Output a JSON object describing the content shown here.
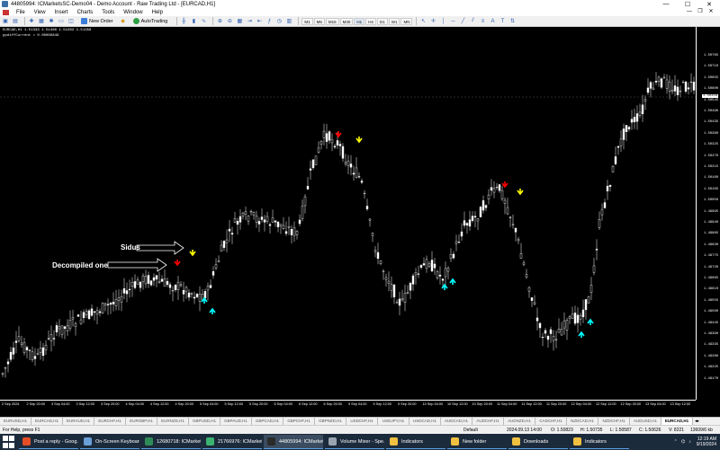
{
  "window": {
    "title": "44805994: ICMarketsSC-Demo04 - Demo Account - Raw Trading Ltd - [EURCAD,H1]",
    "minimize": "—",
    "maximize": "☐",
    "close": "✕"
  },
  "menu": {
    "items": [
      "File",
      "View",
      "Insert",
      "Charts",
      "Tools",
      "Window",
      "Help"
    ]
  },
  "toolbar": {
    "new_order": "New Order",
    "auto_trading": "AutoTrading",
    "timeframes": [
      "M1",
      "M5",
      "M15",
      "M30",
      "H1",
      "H4",
      "D1",
      "W1",
      "MN"
    ],
    "active_timeframe": "H1"
  },
  "chart": {
    "symbol_line": "EURCAD,H1  1.51333 1.51460 1.51282 1.51358",
    "indicator_line": "ppdiffCurrent = 0.00009849",
    "annotation_sidus": "Sidus",
    "annotation_decompiled": "Decompiled one",
    "price_labels": [
      "1.50765",
      "1.50710",
      "1.50655",
      "1.50600",
      "1.50545",
      "1.50490",
      "1.50435",
      "1.50380",
      "1.50325",
      "1.50270",
      "1.50215",
      "1.50160",
      "1.50105",
      "1.50050",
      "1.49995",
      "1.49940",
      "1.49885",
      "1.49830",
      "1.49775",
      "1.49720",
      "1.49665",
      "1.49610",
      "1.49555",
      "1.49500",
      "1.49445",
      "1.49390",
      "1.49335",
      "1.49280",
      "1.49225",
      "1.49170"
    ],
    "current_price": "1.50358",
    "time_labels": [
      "2 Sep 2024",
      "2 Sep 20:00",
      "3 Sep 04:00",
      "3 Sep 12:00",
      "3 Sep 20:00",
      "4 Sep 04:00",
      "4 Sep 12:00",
      "4 Sep 20:00",
      "5 Sep 04:00",
      "5 Sep 12:00",
      "5 Sep 20:00",
      "6 Sep 04:00",
      "6 Sep 12:00",
      "6 Sep 20:00",
      "9 Sep 04:00",
      "9 Sep 12:00",
      "9 Sep 20:00",
      "10 Sep 04:00",
      "10 Sep 12:00",
      "10 Sep 20:00",
      "11 Sep 04:00",
      "11 Sep 12:00",
      "11 Sep 20:00",
      "12 Sep 04:00",
      "12 Sep 12:00",
      "12 Sep 20:00",
      "13 Sep 04:00",
      "13 Sep 12:00"
    ],
    "colors": {
      "background": "#000000",
      "candle": "#ffffff",
      "sidus_up": "#00ffff",
      "sidus_down": "#ffff00",
      "decompiled_up": "#00ffff",
      "decompiled_down": "#ff0000"
    }
  },
  "tabs": [
    "EURUSD,H1",
    "EURCAD,H1",
    "EURAUD,H1",
    "EURCHF,H1",
    "EURGBP,H1",
    "EURNZD,H1",
    "GBPUSD,H1",
    "GBPAUD,H1",
    "GBPCAD,H1",
    "GBPCHF,H1",
    "GBPNZD,H1",
    "USDCHF,H1",
    "USDJPY,H1",
    "USDCAD,H1",
    "AUDCAD,H1",
    "AUDCHF,H1",
    "AUDNZD,H1",
    "CADCHF,H1",
    "NZDCAD,H1",
    "NZDCHF,H1",
    "AUDUSD,H1",
    "EURCAD,H1"
  ],
  "active_tab_index": 21,
  "status": {
    "help": "For Help, press F1",
    "profile": "Default",
    "time": "2024.09.13 14:00",
    "open": "O: 1.50823",
    "high": "H: 1.50735",
    "low": "L: 1.50587",
    "close": "C: 1.50626",
    "volume": "V: 8221",
    "traffic": "13609/6 kb"
  },
  "taskbar": {
    "items": [
      {
        "label": "Post a reply - Goog...",
        "color": "#e44d26"
      },
      {
        "label": "On-Screen Keyboard",
        "color": "#6aa0d8"
      },
      {
        "label": "12680718: ICMarket...",
        "color": "#2e8b57"
      },
      {
        "label": "21766976: ICMarket...",
        "color": "#3cb371"
      },
      {
        "label": "44805994: ICMarket...",
        "color": "#2a2a2a"
      },
      {
        "label": "Volume Mixer - Spe...",
        "color": "#9aa4b0"
      },
      {
        "label": "Indicators",
        "color": "#f0c040"
      },
      {
        "label": "New folder",
        "color": "#f0c040"
      },
      {
        "label": "Downloads",
        "color": "#f0c040"
      },
      {
        "label": "Indicators",
        "color": "#f0c040"
      }
    ],
    "active_index": 4,
    "clock_time": "12:19 AM",
    "clock_date": "9/19/2024"
  }
}
